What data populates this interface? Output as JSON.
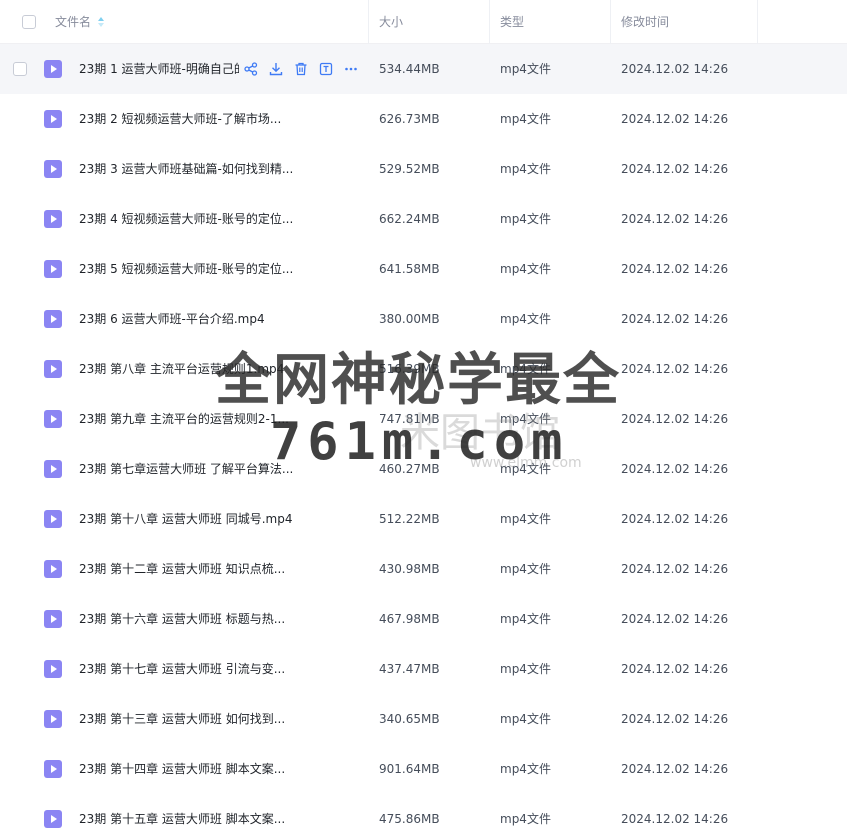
{
  "header": {
    "name_label": "文件名",
    "size_label": "大小",
    "type_label": "类型",
    "modified_label": "修改时间"
  },
  "colors": {
    "file_icon": "#8b85f3",
    "action_icon": "#3f7bf5",
    "hover_row": "#f5f6f9"
  },
  "rows": [
    {
      "name": "23期 1 运营大师班-明确自己的",
      "size": "534.44MB",
      "type": "mp4文件",
      "modified": "2024.12.02 14:26"
    },
    {
      "name": "23期 2 短视频运营大师班-了解市场...",
      "size": "626.73MB",
      "type": "mp4文件",
      "modified": "2024.12.02 14:26"
    },
    {
      "name": "23期 3 运营大师班基础篇-如何找到精...",
      "size": "529.52MB",
      "type": "mp4文件",
      "modified": "2024.12.02 14:26"
    },
    {
      "name": "23期 4 短视频运营大师班-账号的定位...",
      "size": "662.24MB",
      "type": "mp4文件",
      "modified": "2024.12.02 14:26"
    },
    {
      "name": "23期 5 短视频运营大师班-账号的定位...",
      "size": "641.58MB",
      "type": "mp4文件",
      "modified": "2024.12.02 14:26"
    },
    {
      "name": "23期 6 运营大师班-平台介绍.mp4",
      "size": "380.00MB",
      "type": "mp4文件",
      "modified": "2024.12.02 14:26"
    },
    {
      "name": "23期 第八章 主流平台运营规则1.mp4",
      "size": "516.39MB",
      "type": "mp4文件",
      "modified": "2024.12.02 14:26"
    },
    {
      "name": "23期 第九章 主流平台的运营规则2-1...",
      "size": "747.81MB",
      "type": "mp4文件",
      "modified": "2024.12.02 14:26"
    },
    {
      "name": "23期 第七章运营大师班 了解平台算法...",
      "size": "460.27MB",
      "type": "mp4文件",
      "modified": "2024.12.02 14:26"
    },
    {
      "name": "23期 第十八章 运营大师班 同城号.mp4",
      "size": "512.22MB",
      "type": "mp4文件",
      "modified": "2024.12.02 14:26"
    },
    {
      "name": "23期 第十二章 运营大师班 知识点梳...",
      "size": "430.98MB",
      "type": "mp4文件",
      "modified": "2024.12.02 14:26"
    },
    {
      "name": "23期 第十六章 运营大师班 标题与热...",
      "size": "467.98MB",
      "type": "mp4文件",
      "modified": "2024.12.02 14:26"
    },
    {
      "name": "23期 第十七章 运营大师班 引流与变...",
      "size": "437.47MB",
      "type": "mp4文件",
      "modified": "2024.12.02 14:26"
    },
    {
      "name": "23期 第十三章 运营大师班 如何找到...",
      "size": "340.65MB",
      "type": "mp4文件",
      "modified": "2024.12.02 14:26"
    },
    {
      "name": "23期 第十四章 运营大师班 脚本文案...",
      "size": "901.64MB",
      "type": "mp4文件",
      "modified": "2024.12.02 14:26"
    },
    {
      "name": "23期 第十五章 运营大师班 脚本文案...",
      "size": "475.86MB",
      "type": "mp4文件",
      "modified": "2024.12.02 14:26"
    }
  ],
  "watermark": {
    "line1": "全网神秘学最全",
    "line2": "761m.com",
    "faint": "米图书馆",
    "faint_url": "www.elmm.com"
  }
}
